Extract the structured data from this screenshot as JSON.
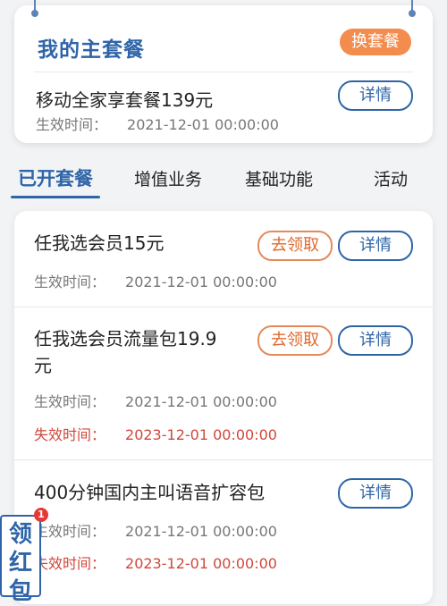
{
  "main_plan": {
    "title": "我的主套餐",
    "switch_label": "换套餐",
    "plan_name": "移动全家享套餐139元",
    "effective_label": "生效时间：",
    "effective_value": "2021-12-01 00:00:00",
    "detail_label": "详情"
  },
  "tabs": [
    {
      "label": "已开套餐"
    },
    {
      "label": "增值业务"
    },
    {
      "label": "基础功能"
    },
    {
      "label": "活动"
    }
  ],
  "items": [
    {
      "name": "任我选会员15元",
      "claim_label": "去领取",
      "detail_label": "详情",
      "effective_label": "生效时间：",
      "effective_value": "2021-12-01 00:00:00"
    },
    {
      "name_line1": "任我选会员流量包19.9",
      "name_line2": "元",
      "claim_label": "去领取",
      "detail_label": "详情",
      "effective_label": "生效时间：",
      "effective_value": "2021-12-01 00:00:00",
      "expire_label": "失效时间：",
      "expire_value": "2023-12-01 00:00:00"
    },
    {
      "name": "400分钟国内主叫语音扩容包",
      "detail_label": "详情",
      "effective_label": "生效时间：",
      "effective_value": "2021-12-01 00:00:00",
      "expire_label": "失效时间：",
      "expire_value": "2023-12-01 00:00:00"
    }
  ],
  "float_badge": {
    "line1": "领",
    "line2": "红",
    "line3": "包",
    "count": "1"
  },
  "colors": {
    "accent_blue": "#2f65a8",
    "orange": "#f38c4d",
    "expire_red": "#d0473c"
  }
}
